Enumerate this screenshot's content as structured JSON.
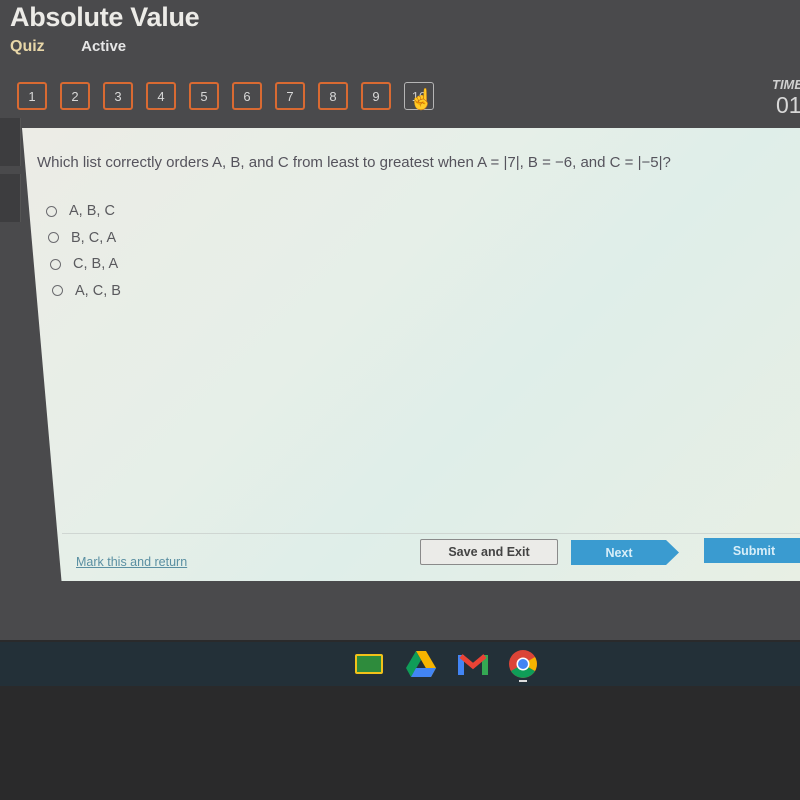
{
  "header": {
    "title": "Absolute Value",
    "tabs": [
      {
        "label": "Quiz"
      },
      {
        "label": "Active"
      }
    ]
  },
  "question_nav": {
    "items": [
      "1",
      "2",
      "3",
      "4",
      "5",
      "6",
      "7",
      "8",
      "9",
      "10"
    ],
    "current": "10",
    "accent_color": "#d96a32"
  },
  "timer": {
    "label": "TIME",
    "value": "01"
  },
  "question": {
    "text": "Which list correctly orders A, B, and C from least to greatest when A = |7|, B = −6, and  C = |−5|?",
    "options": [
      {
        "label": "A, B, C",
        "selected": false
      },
      {
        "label": "B, C, A",
        "selected": false
      },
      {
        "label": "C, B, A",
        "selected": false
      },
      {
        "label": "A, C, B",
        "selected": false
      }
    ]
  },
  "footer": {
    "mark_link": "Mark this and return",
    "save_exit": "Save and Exit",
    "next": "Next",
    "submit": "Submit",
    "button_color": "#3a9bd0"
  },
  "taskbar": {
    "apps": [
      {
        "name": "google-classroom-icon"
      },
      {
        "name": "google-drive-icon"
      },
      {
        "name": "gmail-icon"
      },
      {
        "name": "chrome-icon"
      }
    ]
  }
}
